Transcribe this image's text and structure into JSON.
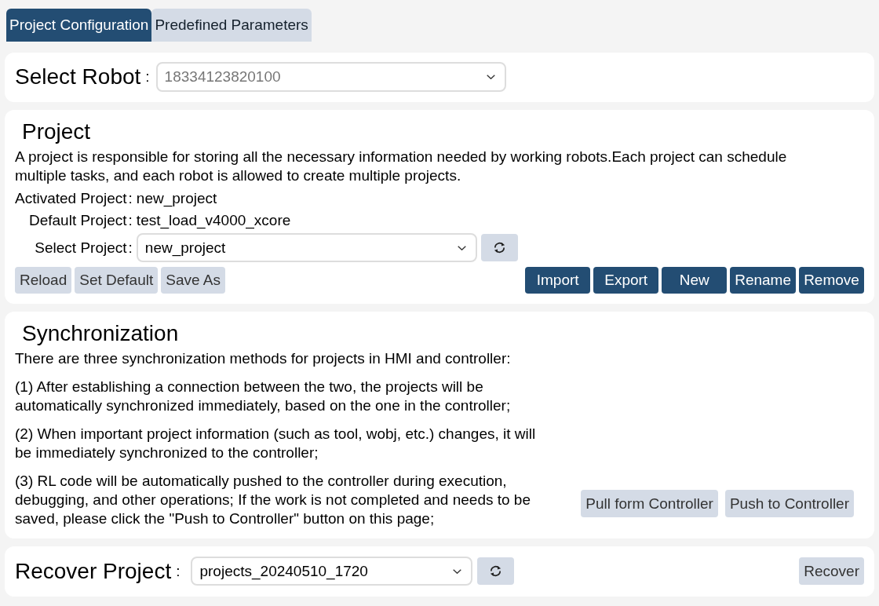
{
  "tabs": [
    {
      "label": "Project Configuration",
      "selected": true
    },
    {
      "label": "Predefined Parameters",
      "selected": false
    }
  ],
  "robot_panel": {
    "label": "Select Robot",
    "colon": ":",
    "select": {
      "value": "18334123820100",
      "disabled": true
    }
  },
  "project_panel": {
    "title": "Project",
    "description": "A project is responsible for storing all the necessary information needed by working robots.Each project can schedule multiple tasks, and each robot is allowed to create multiple projects.",
    "fields": [
      {
        "kind": "text",
        "label": "Activated Project",
        "colon": ":",
        "value": "new_project"
      },
      {
        "kind": "text",
        "label": "Default Project",
        "colon": ":",
        "value": "test_load_v4000_xcore"
      },
      {
        "kind": "select",
        "label": "Select Project",
        "colon": ":",
        "value": "new_project"
      }
    ],
    "left_buttons": [
      "Reload",
      "Set Default",
      "Save As"
    ],
    "right_buttons": [
      "Import",
      "Export",
      "New",
      "Rename",
      "Remove"
    ]
  },
  "sync_panel": {
    "title": "Synchronization",
    "paragraphs": [
      "There are three synchronization methods for projects in HMI and controller:",
      "(1) After establishing a connection between the two, the projects will be automatically synchronized immediately, based on the one in the controller;",
      "(2) When important project information (such as tool, wobj, etc.) changes, it will be immediately synchronized to the controller;",
      "(3) RL code will be automatically pushed to the controller during execution, debugging, and other operations; If the work is not completed and needs to be saved, please click the \"Push to Controller\" button on this page;"
    ],
    "buttons": [
      "Pull form Controller",
      "Push to Controller"
    ]
  },
  "recover_panel": {
    "label": "Recover Project",
    "colon": ":",
    "select": {
      "value": "projects_20240510_1720"
    },
    "button": "Recover"
  }
}
